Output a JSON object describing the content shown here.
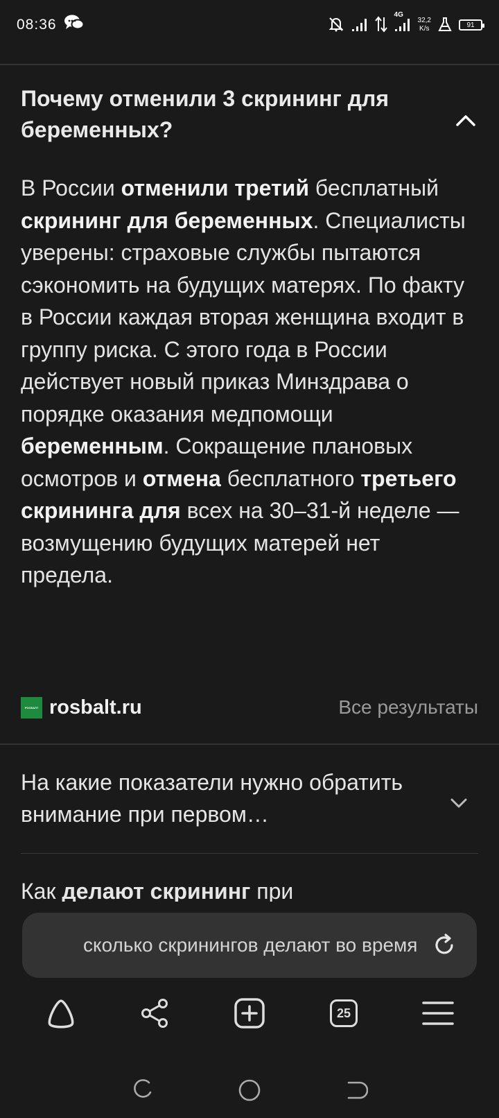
{
  "status_bar": {
    "time": "08:36",
    "network_type": "4G",
    "net_speed_value": "32,2",
    "net_speed_unit": "K/s",
    "battery": "91"
  },
  "faq_open": {
    "question": "Почему отменили 3 скрининг для беременных?",
    "answer_parts": [
      {
        "t": "В России ",
        "b": false
      },
      {
        "t": "отменили третий",
        "b": true
      },
      {
        "t": " бесплатный ",
        "b": false
      },
      {
        "t": "скрининг для беременных",
        "b": true
      },
      {
        "t": ". Специалисты уверены: страховые службы пытаются сэкономить на будущих матерях. По факту в России каждая вторая женщина входит в группу риска. С этого года в России действует новый приказ Минздрава о порядке оказания медпомощи ",
        "b": false
      },
      {
        "t": "беременным",
        "b": true
      },
      {
        "t": ". Сокращение плановых осмотров и ",
        "b": false
      },
      {
        "t": "отмена",
        "b": true
      },
      {
        "t": " бесплатного ",
        "b": false
      },
      {
        "t": "третьего скрининга для",
        "b": true
      },
      {
        "t": " всех на 30–31-й неделе — возмущению будущих матерей нет предела.",
        "b": false
      }
    ],
    "source_logo_text": "РОСБАЛТ",
    "source": "rosbalt.ru",
    "all_results": "Все результаты"
  },
  "faq_closed": {
    "question": "На какие показатели нужно обратить внимание при первом…"
  },
  "faq_next": {
    "parts": [
      {
        "t": "Как ",
        "b": false
      },
      {
        "t": "делают скрининг",
        "b": true
      },
      {
        "t": " при",
        "b": false
      }
    ]
  },
  "search": {
    "query": "сколько скринингов делают во время беременности"
  },
  "toolbar": {
    "tabs_count": "25"
  }
}
